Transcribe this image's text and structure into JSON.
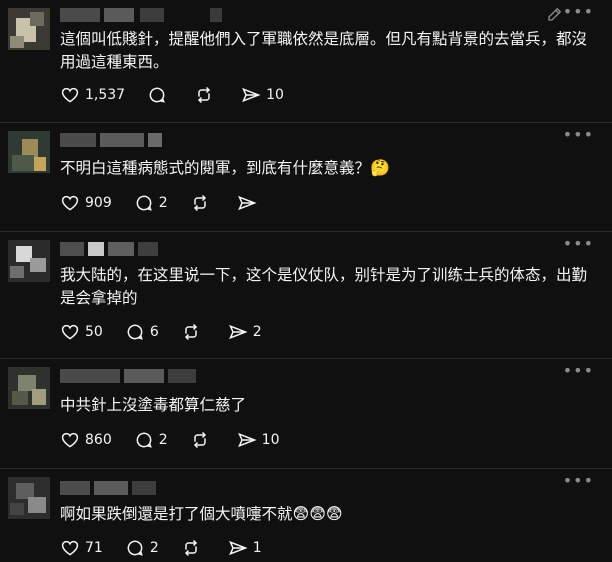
{
  "replies": [
    {
      "text": "這個叫低賤針，提醒他們入了軍職依然是底層。但凡有點背景的去當兵，都沒用過這種東西。",
      "likes": "1,537",
      "comments": "",
      "reposts": "",
      "shares": "10"
    },
    {
      "text": "不明白這種病態式的閱軍，到底有什麼意義？",
      "emoji": "🤔",
      "likes": "909",
      "comments": "2",
      "reposts": "",
      "shares": ""
    },
    {
      "text": "我大陆的，在这里说一下，这个是仪仗队，别针是为了训练士兵的体态，出勤是会拿掉的",
      "likes": "50",
      "comments": "6",
      "reposts": "",
      "shares": "2"
    },
    {
      "text": "中共針上沒塗毒都算仁慈了",
      "likes": "860",
      "comments": "2",
      "reposts": "",
      "shares": "10"
    },
    {
      "text": "啊如果跌倒還是打了個大噴嚏不就",
      "emoji": "😨😨😨",
      "likes": "71",
      "comments": "2",
      "reposts": "",
      "shares": "1"
    }
  ],
  "icons": {
    "like": "heart-icon",
    "comment": "comment-bubble-icon",
    "repost": "repost-icon",
    "share": "share-send-icon",
    "more": "more-dots-icon",
    "edit": "pencil-icon"
  }
}
